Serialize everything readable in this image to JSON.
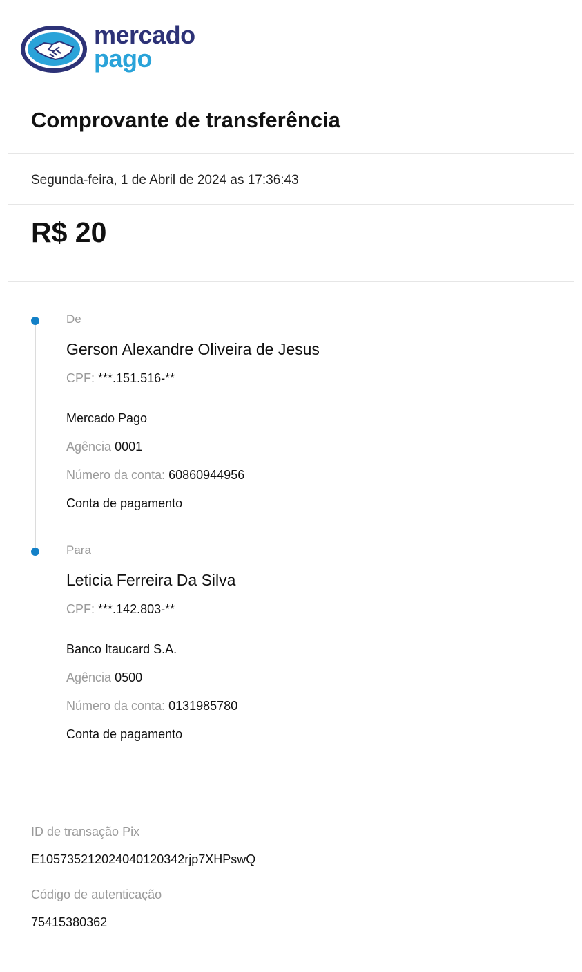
{
  "brand": {
    "line1": "mercado",
    "line2": "pago",
    "colors": {
      "navy": "#2d3277",
      "blue": "#2aa3d9"
    }
  },
  "receipt": {
    "title": "Comprovante de transferência",
    "datetime": "Segunda-feira, 1 de Abril de 2024 as 17:36:43",
    "amount": "R$ 20"
  },
  "from": {
    "role": "De",
    "name": "Gerson Alexandre Oliveira de Jesus",
    "cpf_label": "CPF:",
    "cpf": "***.151.516-**",
    "bank": "Mercado Pago",
    "agency_label": "Agência",
    "agency": "0001",
    "account_label": "Número da conta:",
    "account": "60860944956",
    "account_type": "Conta de pagamento"
  },
  "to": {
    "role": "Para",
    "name": "Leticia Ferreira Da Silva",
    "cpf_label": "CPF:",
    "cpf": "***.142.803-**",
    "bank": "Banco Itaucard S.A.",
    "agency_label": "Agência",
    "agency": "0500",
    "account_label": "Número da conta:",
    "account": "0131985780",
    "account_type": "Conta de pagamento"
  },
  "transaction": {
    "pix_id_label": "ID de transação Pix",
    "pix_id": "E10573521202404012034 2rjp7XHPswQ",
    "auth_label": "Código de autenticação",
    "auth_code": "75415380362"
  },
  "accent_color": "#1380c7"
}
